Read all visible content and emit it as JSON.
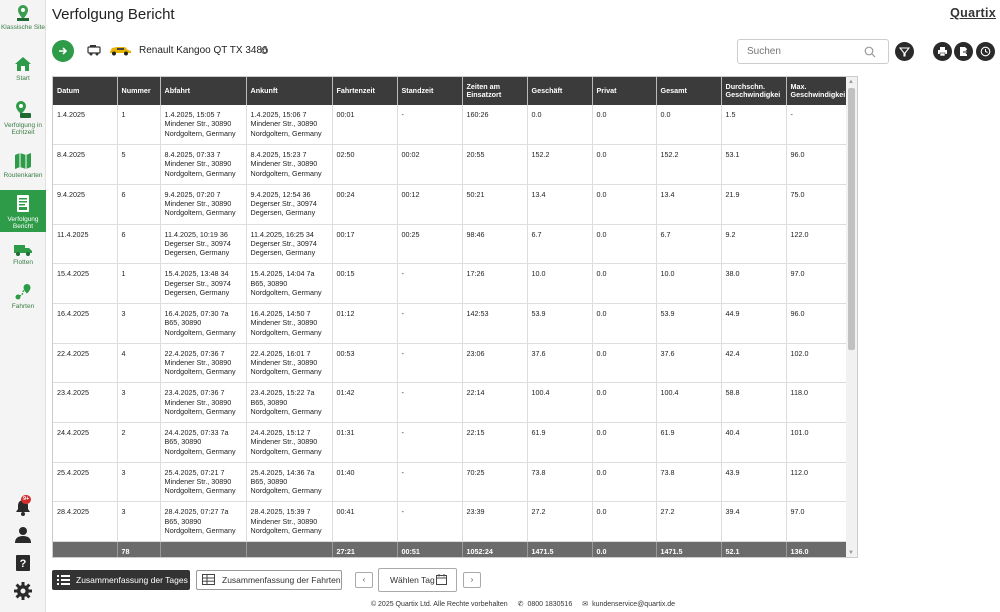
{
  "sidebar": {
    "items": [
      {
        "label": "Klassische Site",
        "icon": "map-pin-icon"
      },
      {
        "label": "Start",
        "icon": "home-icon"
      },
      {
        "label": "Verfolgung in Echtzeit",
        "icon": "realtime-tracking-icon"
      },
      {
        "label": "Routenkarten",
        "icon": "route-map-icon"
      },
      {
        "label": "Verfolgung Bericht",
        "icon": "report-icon",
        "active": true
      },
      {
        "label": "Flotten",
        "icon": "truck-icon"
      },
      {
        "label": "Fahrten",
        "icon": "trips-icon"
      }
    ],
    "notification_badge": "9+"
  },
  "header": {
    "title": "Verfolgung Bericht",
    "brand": "Quartix",
    "vehicle": "Renault Kangoo QT TX 3486",
    "search_placeholder": "Suchen"
  },
  "table": {
    "columns": [
      "Datum",
      "Nummer",
      "Abfahrt",
      "Ankunft",
      "Fahrtenzeit",
      "Standzeit",
      "Zeiten am Einsatzort",
      "Geschäft",
      "Privat",
      "Gesamt",
      "Durchschn. Geschwindigkei",
      "Max. Geschwindigkei"
    ],
    "rows": [
      {
        "datum": "1.4.2025",
        "nummer": "1",
        "abfahrt": [
          "1.4.2025, 15:05 7",
          "Mindener Str., 30890",
          "Nordgoltern, Germany"
        ],
        "ankunft": [
          "1.4.2025, 15:06 7",
          "Mindener Str., 30890",
          "Nordgoltern, Germany"
        ],
        "fahrtenzeit": "00:01",
        "standzeit": "-",
        "einsatzort": "160:26",
        "geschaeft": "0.0",
        "privat": "0.0",
        "gesamt": "0.0",
        "durchschn": "1.5",
        "max": "-"
      },
      {
        "datum": "8.4.2025",
        "nummer": "5",
        "abfahrt": [
          "8.4.2025, 07:33 7",
          "Mindener Str., 30890",
          "Nordgoltern, Germany"
        ],
        "ankunft": [
          "8.4.2025, 15:23 7",
          "Mindener Str., 30890",
          "Nordgoltern, Germany"
        ],
        "fahrtenzeit": "02:50",
        "standzeit": "00:02",
        "einsatzort": "20:55",
        "geschaeft": "152.2",
        "privat": "0.0",
        "gesamt": "152.2",
        "durchschn": "53.1",
        "max": "96.0"
      },
      {
        "datum": "9.4.2025",
        "nummer": "6",
        "abfahrt": [
          "9.4.2025, 07:20 7",
          "Mindener Str., 30890",
          "Nordgoltern, Germany"
        ],
        "ankunft": [
          "9.4.2025, 12:54 36",
          "Degerser Str., 30974",
          "Degersen, Germany"
        ],
        "fahrtenzeit": "00:24",
        "standzeit": "00:12",
        "einsatzort": "50:21",
        "geschaeft": "13.4",
        "privat": "0.0",
        "gesamt": "13.4",
        "durchschn": "21.9",
        "max": "75.0"
      },
      {
        "datum": "11.4.2025",
        "nummer": "6",
        "abfahrt": [
          "11.4.2025, 10:19 36",
          "Degerser Str., 30974",
          "Degersen, Germany"
        ],
        "ankunft": [
          "11.4.2025, 16:25 34",
          "Degerser Str., 30974",
          "Degersen, Germany"
        ],
        "fahrtenzeit": "00:17",
        "standzeit": "00:25",
        "einsatzort": "98:46",
        "geschaeft": "6.7",
        "privat": "0.0",
        "gesamt": "6.7",
        "durchschn": "9.2",
        "max": "122.0"
      },
      {
        "datum": "15.4.2025",
        "nummer": "1",
        "abfahrt": [
          "15.4.2025, 13:48 34",
          "Degerser Str., 30974",
          "Degersen, Germany"
        ],
        "ankunft": [
          "15.4.2025, 14:04 7a",
          "B65, 30890",
          "Nordgoltern, Germany"
        ],
        "fahrtenzeit": "00:15",
        "standzeit": "-",
        "einsatzort": "17:26",
        "geschaeft": "10.0",
        "privat": "0.0",
        "gesamt": "10.0",
        "durchschn": "38.0",
        "max": "97.0"
      },
      {
        "datum": "16.4.2025",
        "nummer": "3",
        "abfahrt": [
          "16.4.2025, 07:30 7a",
          "B65, 30890",
          "Nordgoltern, Germany"
        ],
        "ankunft": [
          "16.4.2025, 14:50 7",
          "Mindener Str., 30890",
          "Nordgoltern, Germany"
        ],
        "fahrtenzeit": "01:12",
        "standzeit": "-",
        "einsatzort": "142:53",
        "geschaeft": "53.9",
        "privat": "0.0",
        "gesamt": "53.9",
        "durchschn": "44.9",
        "max": "96.0"
      },
      {
        "datum": "22.4.2025",
        "nummer": "4",
        "abfahrt": [
          "22.4.2025, 07:36 7",
          "Mindener Str., 30890",
          "Nordgoltern, Germany"
        ],
        "ankunft": [
          "22.4.2025, 16:01 7",
          "Mindener Str., 30890",
          "Nordgoltern, Germany"
        ],
        "fahrtenzeit": "00:53",
        "standzeit": "-",
        "einsatzort": "23:06",
        "geschaeft": "37.6",
        "privat": "0.0",
        "gesamt": "37.6",
        "durchschn": "42.4",
        "max": "102.0"
      },
      {
        "datum": "23.4.2025",
        "nummer": "3",
        "abfahrt": [
          "23.4.2025, 07:36 7",
          "Mindener Str., 30890",
          "Nordgoltern, Germany"
        ],
        "ankunft": [
          "23.4.2025, 15:22 7a",
          "B65, 30890",
          "Nordgoltern, Germany"
        ],
        "fahrtenzeit": "01:42",
        "standzeit": "-",
        "einsatzort": "22:14",
        "geschaeft": "100.4",
        "privat": "0.0",
        "gesamt": "100.4",
        "durchschn": "58.8",
        "max": "118.0"
      },
      {
        "datum": "24.4.2025",
        "nummer": "2",
        "abfahrt": [
          "24.4.2025, 07:33 7a",
          "B65, 30890",
          "Nordgoltern, Germany"
        ],
        "ankunft": [
          "24.4.2025, 15:12 7",
          "Mindener Str., 30890",
          "Nordgoltern, Germany"
        ],
        "fahrtenzeit": "01:31",
        "standzeit": "-",
        "einsatzort": "22:15",
        "geschaeft": "61.9",
        "privat": "0.0",
        "gesamt": "61.9",
        "durchschn": "40.4",
        "max": "101.0"
      },
      {
        "datum": "25.4.2025",
        "nummer": "3",
        "abfahrt": [
          "25.4.2025, 07:21 7",
          "Mindener Str., 30890",
          "Nordgoltern, Germany"
        ],
        "ankunft": [
          "25.4.2025, 14:36 7a",
          "B65, 30890",
          "Nordgoltern, Germany"
        ],
        "fahrtenzeit": "01:40",
        "standzeit": "-",
        "einsatzort": "70:25",
        "geschaeft": "73.8",
        "privat": "0.0",
        "gesamt": "73.8",
        "durchschn": "43.9",
        "max": "112.0"
      },
      {
        "datum": "28.4.2025",
        "nummer": "3",
        "abfahrt": [
          "28.4.2025, 07:27 7a",
          "B65, 30890",
          "Nordgoltern, Germany"
        ],
        "ankunft": [
          "28.4.2025, 15:39 7",
          "Mindener Str., 30890",
          "Nordgoltern, Germany"
        ],
        "fahrtenzeit": "00:41",
        "standzeit": "-",
        "einsatzort": "23:39",
        "geschaeft": "27.2",
        "privat": "0.0",
        "gesamt": "27.2",
        "durchschn": "39.4",
        "max": "97.0"
      }
    ],
    "totals": {
      "datum": "",
      "nummer": "78",
      "abfahrt": "",
      "ankunft": "",
      "fahrtenzeit": "27:21",
      "standzeit": "00:51",
      "einsatzort": "1052:24",
      "geschaeft": "1471.5",
      "privat": "0.0",
      "gesamt": "1471.5",
      "durchschn": "52.1",
      "max": "136.0"
    }
  },
  "bottom": {
    "summary_days": "Zusammenfassung der Tages",
    "summary_trips": "Zusammenfassung der Fahrten",
    "choose_day": "Wählen Tag"
  },
  "footer": {
    "copyright": "© 2025 Quartix Ltd. Alle Rechte vorbehalten",
    "phone": "0800 1830516",
    "email": "kundenservice@quartix.de"
  },
  "colors": {
    "accent": "#2e9b48",
    "header_bg": "#3b3b3b",
    "total_bg": "#6b6b6b"
  }
}
